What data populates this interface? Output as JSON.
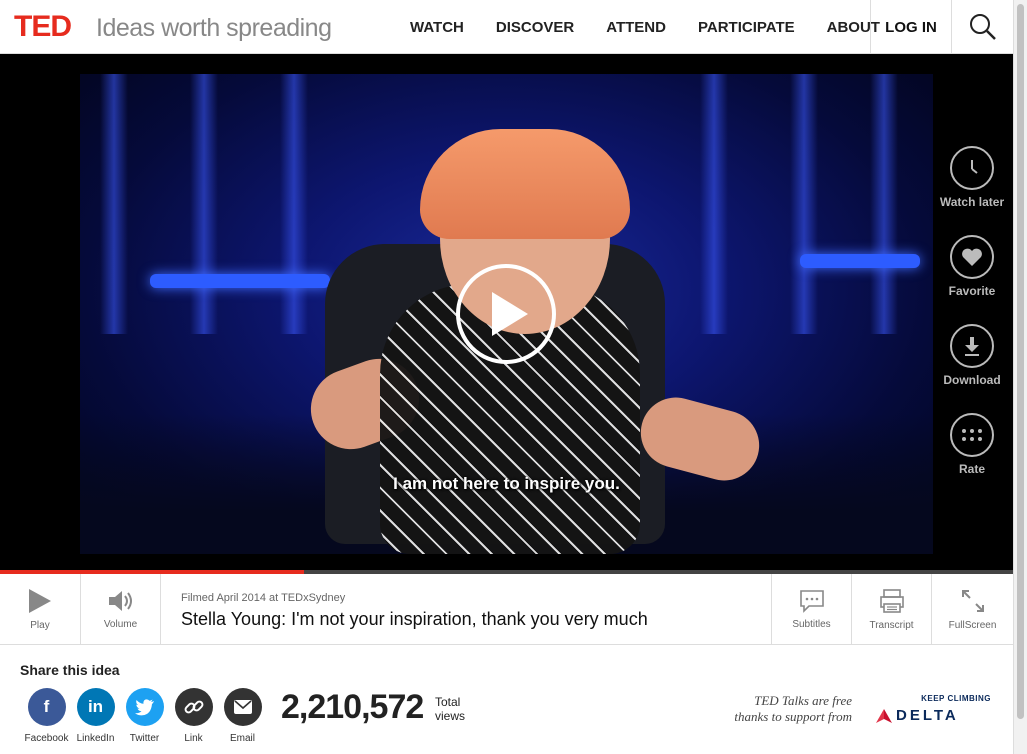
{
  "brand": {
    "logo": "TED",
    "tagline": "Ideas worth spreading",
    "accent": "#e62b1e"
  },
  "nav": {
    "items": [
      "WATCH",
      "DISCOVER",
      "ATTEND",
      "PARTICIPATE",
      "ABOUT"
    ],
    "login": "LOG IN",
    "search_icon": "search-icon"
  },
  "video": {
    "caption": "I am not here to inspire you.",
    "progress_fraction": 0.3
  },
  "side_actions": [
    {
      "label": "Watch later",
      "icon": "clock-icon"
    },
    {
      "label": "Favorite",
      "icon": "heart-icon"
    },
    {
      "label": "Download",
      "icon": "download-icon"
    },
    {
      "label": "Rate",
      "icon": "more-dots-icon"
    }
  ],
  "controls": {
    "play": "Play",
    "volume": "Volume",
    "subtitles": "Subtitles",
    "transcript": "Transcript",
    "fullscreen": "FullScreen"
  },
  "talk": {
    "filmed": "Filmed April 2014 at TEDxSydney",
    "title": "Stella Young: I'm not your inspiration, thank you very much"
  },
  "share": {
    "heading": "Share this idea",
    "items": [
      {
        "label": "Facebook",
        "glyph": "f",
        "color": "#3b5998"
      },
      {
        "label": "LinkedIn",
        "glyph": "in",
        "color": "#0077b5"
      },
      {
        "label": "Twitter",
        "glyph": "t",
        "color": "#1da1f2"
      },
      {
        "label": "Link",
        "glyph": "",
        "color": "#333333"
      },
      {
        "label": "Email",
        "glyph": "",
        "color": "#333333"
      }
    ]
  },
  "stats": {
    "views": "2,210,572",
    "views_label_1": "Total",
    "views_label_2": "views"
  },
  "sponsor": {
    "line1": "TED Talks are free",
    "line2": "thanks to support from",
    "tagline": "KEEP CLIMBING",
    "name": "DELTA"
  }
}
